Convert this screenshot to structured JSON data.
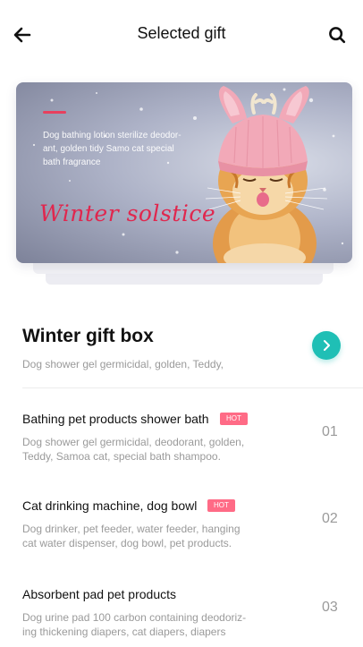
{
  "header": {
    "title": "Selected gift",
    "back_icon": "arrow-left-icon",
    "search_icon": "search-icon"
  },
  "banner": {
    "description": "Dog bathing lotion sterilize deodor-ant, golden tidy Samo cat special bath fragrance",
    "script_text": "Winter solstice",
    "accent_color": "#e8405e"
  },
  "featured": {
    "title": "Winter gift box",
    "subtitle": "Dog shower gel germicidal, golden, Teddy,",
    "button_icon": "chevron-right-icon",
    "button_color": "#1fbfb5"
  },
  "items": [
    {
      "title": "Bathing pet products shower bath",
      "badge": "HOT",
      "description": "Dog shower gel germicidal, deodorant, golden, Teddy, Samoa cat, special bath shampoo.",
      "number": "01"
    },
    {
      "title": "Cat drinking machine, dog bowl",
      "badge": "HOT",
      "description": "Dog drinker, pet feeder, water feeder, hanging cat water dispenser, dog bowl, pet products.",
      "number": "02"
    },
    {
      "title": "Absorbent pad pet products",
      "badge": "",
      "description": "Dog urine pad 100 carbon containing deodoriz-ing thickening diapers, cat diapers, diapers",
      "number": "03"
    }
  ],
  "colors": {
    "hot_badge": "#ff6b86",
    "muted_text": "#9a9a9a"
  }
}
